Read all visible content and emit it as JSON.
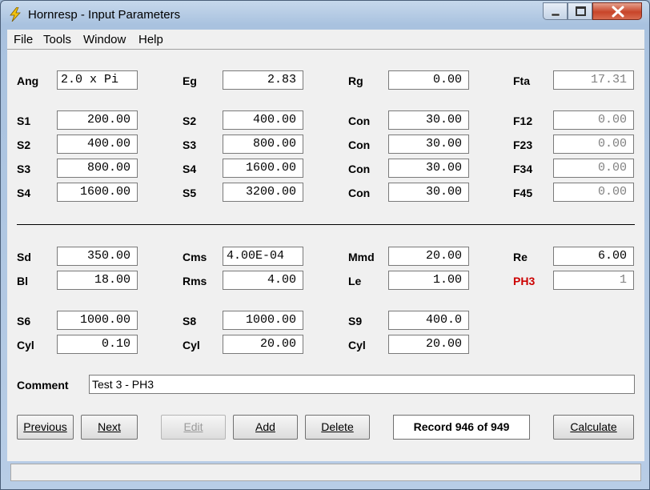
{
  "window": {
    "title": "Hornresp - Input Parameters"
  },
  "menu": [
    "File",
    "Tools",
    "Window",
    "Help"
  ],
  "row_ang": [
    {
      "label": "Ang",
      "value": "2.0 x Pi"
    },
    {
      "label": "Eg",
      "value": "2.83"
    },
    {
      "label": "Rg",
      "value": "0.00"
    },
    {
      "label": "Fta",
      "value": "17.31"
    }
  ],
  "segments": [
    [
      {
        "label": "S1",
        "value": "200.00"
      },
      {
        "label": "S2",
        "value": "400.00"
      },
      {
        "label": "Con",
        "value": "30.00"
      },
      {
        "label": "F12",
        "value": "0.00"
      }
    ],
    [
      {
        "label": "S2",
        "value": "400.00"
      },
      {
        "label": "S3",
        "value": "800.00"
      },
      {
        "label": "Con",
        "value": "30.00"
      },
      {
        "label": "F23",
        "value": "0.00"
      }
    ],
    [
      {
        "label": "S3",
        "value": "800.00"
      },
      {
        "label": "S4",
        "value": "1600.00"
      },
      {
        "label": "Con",
        "value": "30.00"
      },
      {
        "label": "F34",
        "value": "0.00"
      }
    ],
    [
      {
        "label": "S4",
        "value": "1600.00"
      },
      {
        "label": "S5",
        "value": "3200.00"
      },
      {
        "label": "Con",
        "value": "30.00"
      },
      {
        "label": "F45",
        "value": "0.00"
      }
    ]
  ],
  "driver": [
    [
      {
        "label": "Sd",
        "value": "350.00"
      },
      {
        "label": "Cms",
        "value": "4.00E-04"
      },
      {
        "label": "Mmd",
        "value": "20.00"
      },
      {
        "label": "Re",
        "value": "6.00"
      }
    ],
    [
      {
        "label": "Bl",
        "value": "18.00"
      },
      {
        "label": "Rms",
        "value": "4.00"
      },
      {
        "label": "Le",
        "value": "1.00"
      },
      {
        "label": "PH3",
        "value": "1"
      }
    ]
  ],
  "chambers": [
    [
      {
        "label": "S6",
        "value": "1000.00"
      },
      {
        "label": "S8",
        "value": "1000.00"
      },
      {
        "label": "S9",
        "value": "400.0"
      }
    ],
    [
      {
        "label": "Cyl",
        "value": "0.10"
      },
      {
        "label": "Cyl",
        "value": "20.00"
      },
      {
        "label": "Cyl",
        "value": "20.00"
      }
    ]
  ],
  "comment": {
    "label": "Comment",
    "value": "Test 3 - PH3"
  },
  "buttons": {
    "previous": "Previous",
    "next": "Next",
    "edit": "Edit",
    "add": "Add",
    "delete": "Delete",
    "calculate": "Calculate"
  },
  "record": "Record 946 of 949",
  "status": "",
  "colors": {
    "accent_red": "#cc0000",
    "readonly_text": "#808080"
  },
  "icons": [
    "lightning-icon",
    "minimize-icon",
    "maximize-icon",
    "close-icon"
  ]
}
